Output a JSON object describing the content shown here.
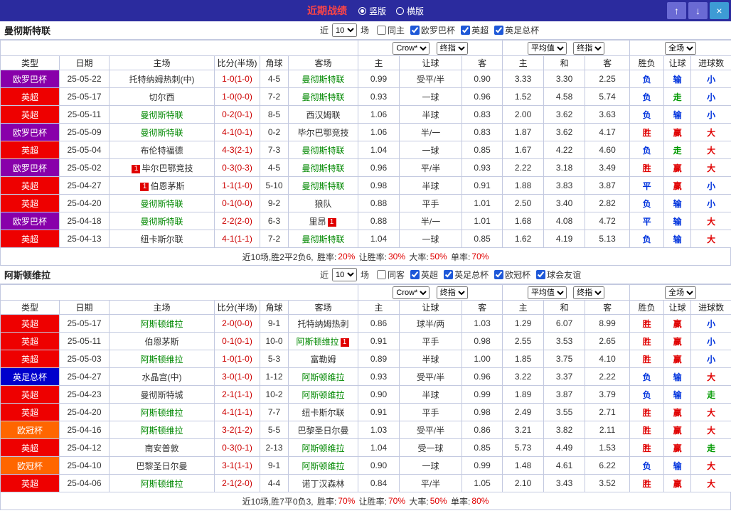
{
  "topbar": {
    "title": "近期战绩",
    "radios": [
      {
        "label": "竖版",
        "selected": true
      },
      {
        "label": "横版",
        "selected": false
      }
    ],
    "buttons": {
      "up": "↑",
      "down": "↓",
      "close": "×"
    }
  },
  "colors": {
    "topbar": "#2b2b9e",
    "title": "#ff4545",
    "border": "#c3c9e0",
    "team_highlight": "#008800",
    "score": "#cc0000",
    "positive": "#e00000",
    "negative": "#0033dd",
    "push": "#009900"
  },
  "league_colors": {
    "欧罗巴杯": "#8800aa",
    "英超": "#ee0000",
    "英足总杯": "#0000cc",
    "欧冠杯": "#ff6600"
  },
  "result_colors": {
    "胜": "#e00000",
    "赢": "#e00000",
    "大": "#e00000",
    "负": "#0033dd",
    "输": "#0033dd",
    "小": "#0033dd",
    "平": "#0033dd",
    "走": "#009900"
  },
  "sections": [
    {
      "team": "曼彻斯特联",
      "filter": {
        "near": "近",
        "count": "10",
        "unit": "场",
        "checkboxes": [
          {
            "label": "同主",
            "checked": false
          },
          {
            "label": "欧罗巴杯",
            "checked": true
          },
          {
            "label": "英超",
            "checked": true
          },
          {
            "label": "英足总杯",
            "checked": true
          }
        ]
      },
      "selects": [
        "Crow*",
        "终指",
        "平均值",
        "终指",
        "全场"
      ],
      "columns": [
        "类型",
        "日期",
        "主场",
        "比分(半场)",
        "角球",
        "客场",
        "主",
        "让球",
        "客",
        "主",
        "和",
        "客",
        "胜负",
        "让球",
        "进球数"
      ],
      "rows": [
        {
          "league": "欧罗巴杯",
          "date": "25-05-22",
          "home": "托特纳姆热刺(中)",
          "score": "1-0(1-0)",
          "corner": "4-5",
          "away": "曼彻斯特联",
          "ahl": true,
          "asia": [
            "0.99",
            "受平/半",
            "0.90"
          ],
          "euro": [
            "3.33",
            "3.30",
            "2.25"
          ],
          "res": [
            "负",
            "输",
            "小"
          ]
        },
        {
          "league": "英超",
          "date": "25-05-17",
          "home": "切尔西",
          "score": "1-0(0-0)",
          "corner": "7-2",
          "away": "曼彻斯特联",
          "ahl": true,
          "asia": [
            "0.93",
            "一球",
            "0.96"
          ],
          "euro": [
            "1.52",
            "4.58",
            "5.74"
          ],
          "res": [
            "负",
            "走",
            "小"
          ]
        },
        {
          "league": "英超",
          "date": "25-05-11",
          "home": "曼彻斯特联",
          "hhl": true,
          "score": "0-2(0-1)",
          "corner": "8-5",
          "away": "西汉姆联",
          "asia": [
            "1.06",
            "半球",
            "0.83"
          ],
          "euro": [
            "2.00",
            "3.62",
            "3.63"
          ],
          "res": [
            "负",
            "输",
            "小"
          ]
        },
        {
          "league": "欧罗巴杯",
          "date": "25-05-09",
          "home": "曼彻斯特联",
          "hhl": true,
          "score": "4-1(0-1)",
          "corner": "0-2",
          "away": "毕尔巴鄂竞技",
          "asia": [
            "1.06",
            "半/一",
            "0.83"
          ],
          "euro": [
            "1.87",
            "3.62",
            "4.17"
          ],
          "res": [
            "胜",
            "赢",
            "大"
          ]
        },
        {
          "league": "英超",
          "date": "25-05-04",
          "home": "布伦特福德",
          "score": "4-3(2-1)",
          "corner": "7-3",
          "away": "曼彻斯特联",
          "ahl": true,
          "asia": [
            "1.04",
            "一球",
            "0.85"
          ],
          "euro": [
            "1.67",
            "4.22",
            "4.60"
          ],
          "res": [
            "负",
            "走",
            "大"
          ]
        },
        {
          "league": "欧罗巴杯",
          "date": "25-05-02",
          "home": "毕尔巴鄂竞技",
          "hb": "1",
          "score": "0-3(0-3)",
          "corner": "4-5",
          "away": "曼彻斯特联",
          "ahl": true,
          "asia": [
            "0.96",
            "平/半",
            "0.93"
          ],
          "euro": [
            "2.22",
            "3.18",
            "3.49"
          ],
          "res": [
            "胜",
            "赢",
            "大"
          ]
        },
        {
          "league": "英超",
          "date": "25-04-27",
          "home": "伯恩茅斯",
          "hb": "1",
          "score": "1-1(1-0)",
          "corner": "5-10",
          "away": "曼彻斯特联",
          "ahl": true,
          "asia": [
            "0.98",
            "半球",
            "0.91"
          ],
          "euro": [
            "1.88",
            "3.83",
            "3.87"
          ],
          "res": [
            "平",
            "赢",
            "小"
          ]
        },
        {
          "league": "英超",
          "date": "25-04-20",
          "home": "曼彻斯特联",
          "hhl": true,
          "score": "0-1(0-0)",
          "corner": "9-2",
          "away": "狼队",
          "asia": [
            "0.88",
            "平手",
            "1.01"
          ],
          "euro": [
            "2.50",
            "3.40",
            "2.82"
          ],
          "res": [
            "负",
            "输",
            "小"
          ]
        },
        {
          "league": "欧罗巴杯",
          "date": "25-04-18",
          "home": "曼彻斯特联",
          "hhl": true,
          "score": "2-2(2-0)",
          "corner": "6-3",
          "away": "里昂",
          "ab": "1",
          "asia": [
            "0.88",
            "半/一",
            "1.01"
          ],
          "euro": [
            "1.68",
            "4.08",
            "4.72"
          ],
          "res": [
            "平",
            "输",
            "大"
          ]
        },
        {
          "league": "英超",
          "date": "25-04-13",
          "home": "纽卡斯尔联",
          "score": "4-1(1-1)",
          "corner": "7-2",
          "away": "曼彻斯特联",
          "ahl": true,
          "asia": [
            "1.04",
            "一球",
            "0.85"
          ],
          "euro": [
            "1.62",
            "4.19",
            "5.13"
          ],
          "res": [
            "负",
            "输",
            "大"
          ]
        }
      ],
      "summary": {
        "prefix": "近10场,胜2平2负6, ",
        "stats": [
          [
            "胜率:",
            "20%"
          ],
          [
            "让胜率:",
            "30%"
          ],
          [
            "大率:",
            "50%"
          ],
          [
            "单率:",
            "70%"
          ]
        ]
      }
    },
    {
      "team": "阿斯顿维拉",
      "filter": {
        "near": "近",
        "count": "10",
        "unit": "场",
        "checkboxes": [
          {
            "label": "同客",
            "checked": false
          },
          {
            "label": "英超",
            "checked": true
          },
          {
            "label": "英足总杯",
            "checked": true
          },
          {
            "label": "欧冠杯",
            "checked": true
          },
          {
            "label": "球会友谊",
            "checked": true
          }
        ]
      },
      "selects": [
        "Crow*",
        "终指",
        "平均值",
        "终指",
        "全场"
      ],
      "columns": [
        "类型",
        "日期",
        "主场",
        "比分(半场)",
        "角球",
        "客场",
        "主",
        "让球",
        "客",
        "主",
        "和",
        "客",
        "胜负",
        "让球",
        "进球数"
      ],
      "rows": [
        {
          "league": "英超",
          "date": "25-05-17",
          "home": "阿斯顿维拉",
          "hhl": true,
          "score": "2-0(0-0)",
          "corner": "9-1",
          "away": "托特纳姆热刺",
          "asia": [
            "0.86",
            "球半/两",
            "1.03"
          ],
          "euro": [
            "1.29",
            "6.07",
            "8.99"
          ],
          "res": [
            "胜",
            "赢",
            "小"
          ]
        },
        {
          "league": "英超",
          "date": "25-05-11",
          "home": "伯恩茅斯",
          "score": "0-1(0-1)",
          "corner": "10-0",
          "away": "阿斯顿维拉",
          "ahl": true,
          "ab": "1",
          "asia": [
            "0.91",
            "平手",
            "0.98"
          ],
          "euro": [
            "2.55",
            "3.53",
            "2.65"
          ],
          "res": [
            "胜",
            "赢",
            "小"
          ]
        },
        {
          "league": "英超",
          "date": "25-05-03",
          "home": "阿斯顿维拉",
          "hhl": true,
          "score": "1-0(1-0)",
          "corner": "5-3",
          "away": "富勒姆",
          "asia": [
            "0.89",
            "半球",
            "1.00"
          ],
          "euro": [
            "1.85",
            "3.75",
            "4.10"
          ],
          "res": [
            "胜",
            "赢",
            "小"
          ]
        },
        {
          "league": "英足总杯",
          "date": "25-04-27",
          "home": "水晶宫(中)",
          "score": "3-0(1-0)",
          "corner": "1-12",
          "away": "阿斯顿维拉",
          "ahl": true,
          "asia": [
            "0.93",
            "受平/半",
            "0.96"
          ],
          "euro": [
            "3.22",
            "3.37",
            "2.22"
          ],
          "res": [
            "负",
            "输",
            "大"
          ]
        },
        {
          "league": "英超",
          "date": "25-04-23",
          "home": "曼彻斯特城",
          "score": "2-1(1-1)",
          "corner": "10-2",
          "away": "阿斯顿维拉",
          "ahl": true,
          "asia": [
            "0.90",
            "半球",
            "0.99"
          ],
          "euro": [
            "1.89",
            "3.87",
            "3.79"
          ],
          "res": [
            "负",
            "输",
            "走"
          ]
        },
        {
          "league": "英超",
          "date": "25-04-20",
          "home": "阿斯顿维拉",
          "hhl": true,
          "score": "4-1(1-1)",
          "corner": "7-7",
          "away": "纽卡斯尔联",
          "asia": [
            "0.91",
            "平手",
            "0.98"
          ],
          "euro": [
            "2.49",
            "3.55",
            "2.71"
          ],
          "res": [
            "胜",
            "赢",
            "大"
          ]
        },
        {
          "league": "欧冠杯",
          "date": "25-04-16",
          "home": "阿斯顿维拉",
          "hhl": true,
          "score": "3-2(1-2)",
          "corner": "5-5",
          "away": "巴黎圣日尔曼",
          "asia": [
            "1.03",
            "受平/半",
            "0.86"
          ],
          "euro": [
            "3.21",
            "3.82",
            "2.11"
          ],
          "res": [
            "胜",
            "赢",
            "大"
          ]
        },
        {
          "league": "英超",
          "date": "25-04-12",
          "home": "南安普敦",
          "score": "0-3(0-1)",
          "corner": "2-13",
          "away": "阿斯顿维拉",
          "ahl": true,
          "asia": [
            "1.04",
            "受一球",
            "0.85"
          ],
          "euro": [
            "5.73",
            "4.49",
            "1.53"
          ],
          "res": [
            "胜",
            "赢",
            "走"
          ]
        },
        {
          "league": "欧冠杯",
          "date": "25-04-10",
          "home": "巴黎圣日尔曼",
          "score": "3-1(1-1)",
          "corner": "9-1",
          "away": "阿斯顿维拉",
          "ahl": true,
          "asia": [
            "0.90",
            "一球",
            "0.99"
          ],
          "euro": [
            "1.48",
            "4.61",
            "6.22"
          ],
          "res": [
            "负",
            "输",
            "大"
          ]
        },
        {
          "league": "英超",
          "date": "25-04-06",
          "home": "阿斯顿维拉",
          "hhl": true,
          "score": "2-1(2-0)",
          "corner": "4-4",
          "away": "诺丁汉森林",
          "asia": [
            "0.84",
            "平/半",
            "1.05"
          ],
          "euro": [
            "2.10",
            "3.43",
            "3.52"
          ],
          "res": [
            "胜",
            "赢",
            "大"
          ]
        }
      ],
      "summary": {
        "prefix": "近10场,胜7平0负3, ",
        "stats": [
          [
            "胜率:",
            "70%"
          ],
          [
            "让胜率:",
            "70%"
          ],
          [
            "大率:",
            "50%"
          ],
          [
            "单率:",
            "80%"
          ]
        ]
      }
    }
  ]
}
